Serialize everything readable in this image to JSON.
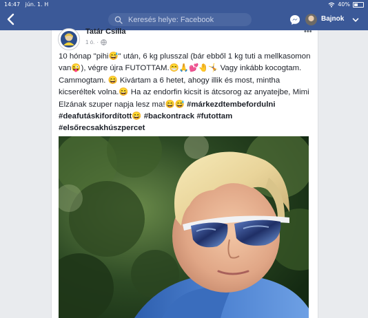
{
  "status_bar": {
    "time": "14:47",
    "date": "jún. 1. H",
    "battery": "40%"
  },
  "nav": {
    "search_placeholder": "Keresés helye: Facebook",
    "profile_name": "Bajnok"
  },
  "post": {
    "author": "Tatár Csilla",
    "time_ago": "1 ó.",
    "text": {
      "p1": "10 hónap \"pihi😅\" után, 6 kg plusszal (bár ebből 1 kg tuti a mellkasomon van😜), végre újra FUTOTTAM.😁🙏💕🤚🤸 Vagy inkább kocogtam. Cammogtam. 😄 Kivártam a 6 hetet, ahogy illik és most, mintha kicseréltek volna.😄 Ha az endorfin kicsit is átcsorog az anyatejbe, Mimi Elzának szuper napja lesz ma!😄😅 ",
      "tag1": "#márkezdtembefordulni",
      "tag2": "#deafutáskifordított",
      "emoji2": "😄 ",
      "tag3": "#backontrack",
      "tag4": "#futottam",
      "tag5": "#elsőrecsakhúszpercet"
    }
  },
  "colors": {
    "facebook_blue": "#3b5998",
    "search_bg": "#4b67a1",
    "card_bg": "#ffffff",
    "page_bg": "#e9ebee"
  },
  "icons": [
    "back-chevron-icon",
    "search-icon",
    "messenger-icon",
    "chevron-down-icon",
    "wifi-icon",
    "battery-icon",
    "globe-icon",
    "more-icon"
  ]
}
